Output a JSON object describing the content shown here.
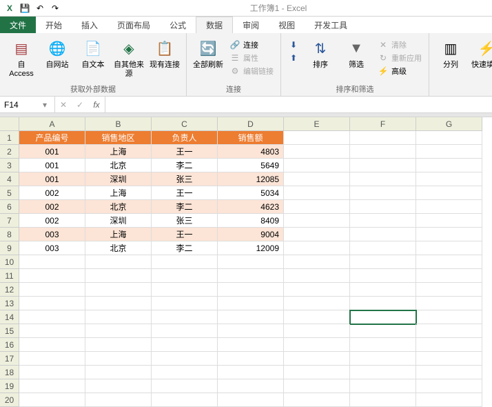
{
  "app": {
    "title": "工作簿1 - Excel"
  },
  "qat": {
    "excel": "X",
    "save": "💾",
    "undo": "↶",
    "redo": "↷"
  },
  "tabs": {
    "file": "文件",
    "items": [
      "开始",
      "插入",
      "页面布局",
      "公式",
      "数据",
      "审阅",
      "视图",
      "开发工具"
    ],
    "active": 4
  },
  "ribbon": {
    "group1": {
      "label": "获取外部数据",
      "btns": [
        "自 Access",
        "自网站",
        "自文本",
        "自其他来源",
        "现有连接"
      ]
    },
    "group2": {
      "label": "连接",
      "main": "全部刷新",
      "items": [
        "连接",
        "属性",
        "编辑链接"
      ]
    },
    "group3": {
      "label": "排序和筛选",
      "sort_asc": "A→Z",
      "sort_desc": "Z→A",
      "sort": "排序",
      "filter": "筛选",
      "clear": "清除",
      "reapply": "重新应用",
      "advanced": "高级"
    },
    "group4": {
      "split": "分列",
      "flash": "快速填充"
    }
  },
  "formula_bar": {
    "name_box": "F14",
    "fx": "fx",
    "cancel": "✕",
    "enter": "✓"
  },
  "columns": [
    "A",
    "B",
    "C",
    "D",
    "E",
    "F",
    "G"
  ],
  "headers": [
    "产品编号",
    "销售地区",
    "负责人",
    "销售额"
  ],
  "rows": [
    {
      "code": "001",
      "region": "上海",
      "person": "王一",
      "amount": 4803
    },
    {
      "code": "001",
      "region": "北京",
      "person": "李二",
      "amount": 5649
    },
    {
      "code": "001",
      "region": "深圳",
      "person": "张三",
      "amount": 12085
    },
    {
      "code": "002",
      "region": "上海",
      "person": "王一",
      "amount": 5034
    },
    {
      "code": "002",
      "region": "北京",
      "person": "李二",
      "amount": 4623
    },
    {
      "code": "002",
      "region": "深圳",
      "person": "张三",
      "amount": 8409
    },
    {
      "code": "003",
      "region": "上海",
      "person": "王一",
      "amount": 9004
    },
    {
      "code": "003",
      "region": "北京",
      "person": "李二",
      "amount": 12009
    }
  ],
  "total_rows": 20,
  "selected_cell": "F14"
}
